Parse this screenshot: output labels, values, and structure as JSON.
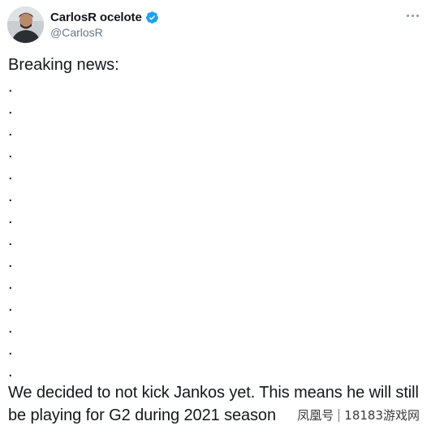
{
  "tweet": {
    "display_name": "CarlosR ocelote",
    "handle": "@CarlosR",
    "headline": "Breaking news:",
    "dots": [
      ".",
      ".",
      ".",
      ".",
      ".",
      ".",
      ".",
      ".",
      ".",
      ".",
      ".",
      ".",
      ".",
      "."
    ],
    "message": "We decided to not kick Jankos yet. This means he will still be playing for G2 during 2021 season"
  },
  "watermark": {
    "left": "凤凰号",
    "right": "18183游戏网"
  },
  "colors": {
    "verified": "#1da1f2",
    "handle": "#657786",
    "text": "#14171a"
  },
  "icons": {
    "verified": "verified-badge-icon",
    "more": "more-options-icon"
  }
}
